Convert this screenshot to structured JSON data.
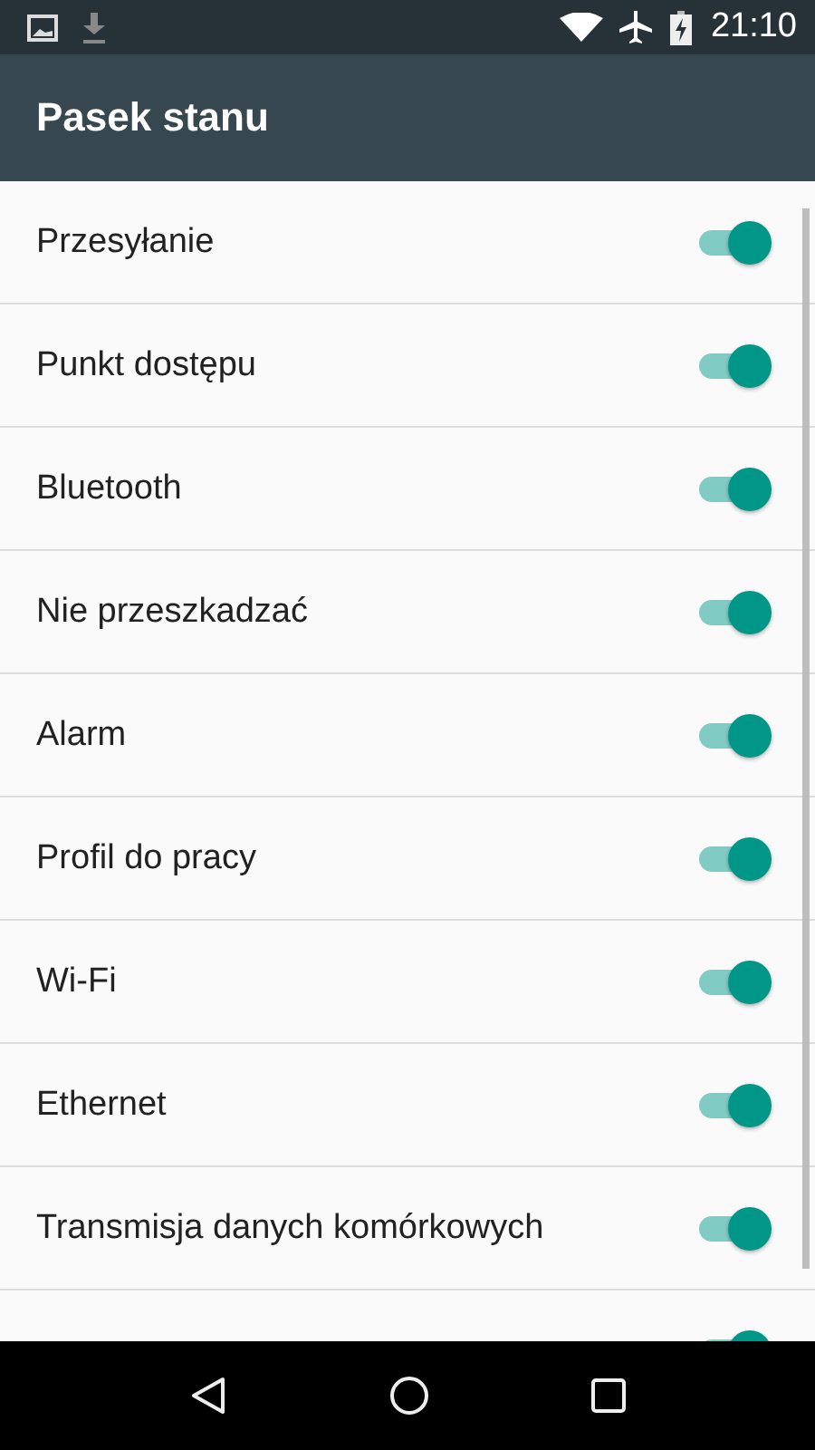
{
  "status_bar": {
    "time": "21:10"
  },
  "toolbar": {
    "title": "Pasek stanu"
  },
  "items": [
    {
      "label": "Przesyłanie",
      "on": true
    },
    {
      "label": "Punkt dostępu",
      "on": true
    },
    {
      "label": "Bluetooth",
      "on": true
    },
    {
      "label": "Nie przeszkadzać",
      "on": true
    },
    {
      "label": "Alarm",
      "on": true
    },
    {
      "label": "Profil do pracy",
      "on": true
    },
    {
      "label": "Wi-Fi",
      "on": true
    },
    {
      "label": "Ethernet",
      "on": true
    },
    {
      "label": "Transmisja danych komórkowych",
      "on": true
    },
    {
      "on": true
    }
  ]
}
